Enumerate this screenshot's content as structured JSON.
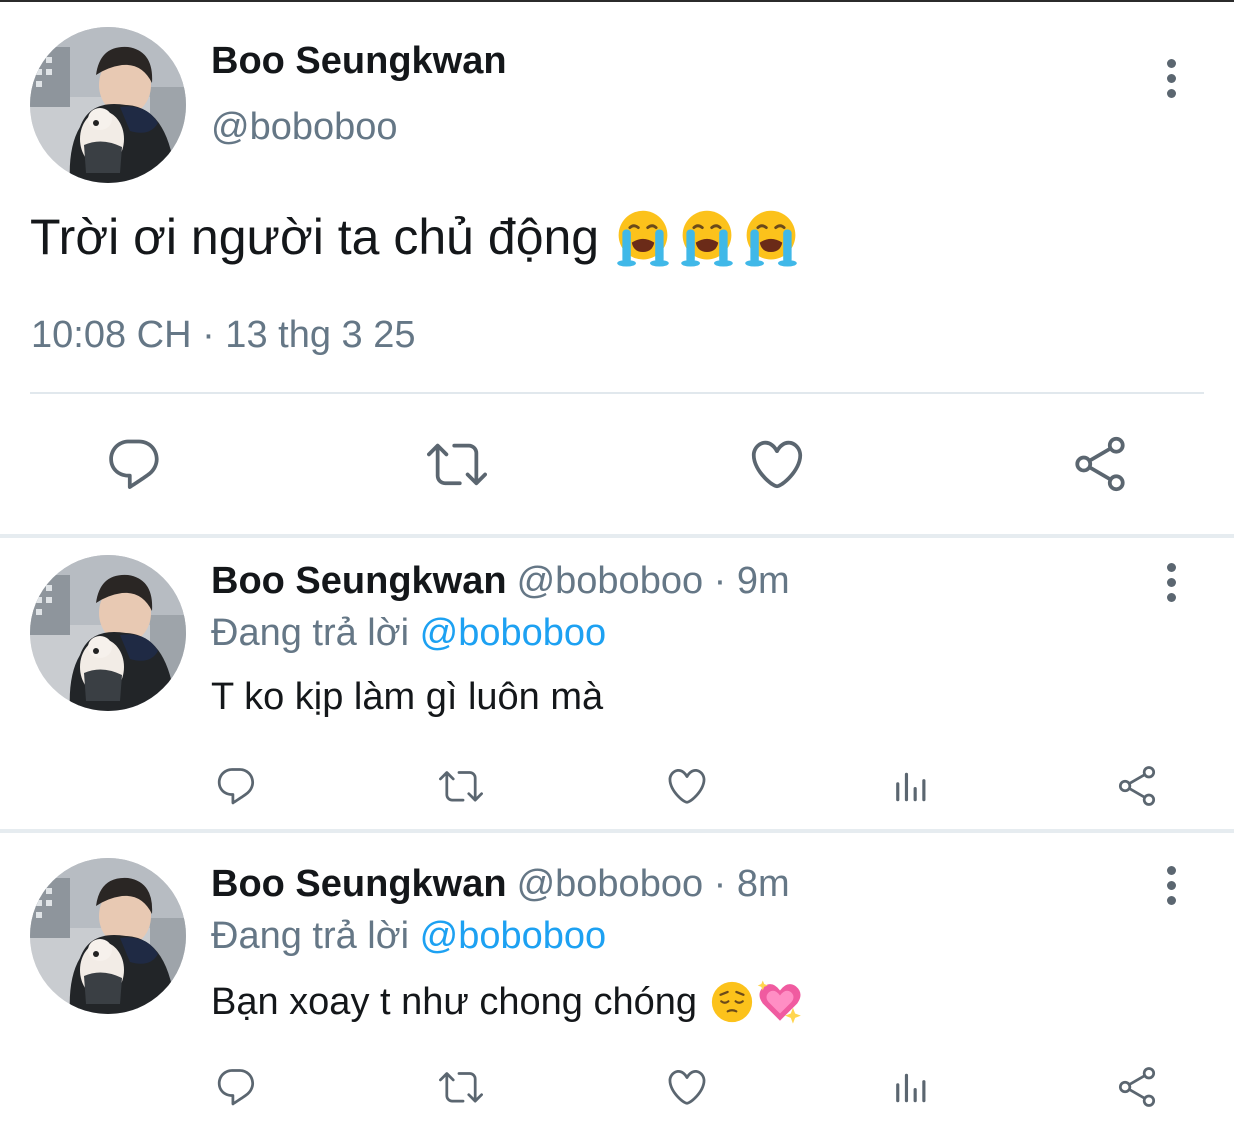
{
  "main_tweet": {
    "author_name": "Boo Seungkwan",
    "author_handle": "@boboboo",
    "text": "Trời ơi người ta chủ động",
    "emojis": [
      "loudly-crying-face",
      "loudly-crying-face",
      "loudly-crying-face"
    ],
    "timestamp": "10:08 CH · 13 thg 3 25",
    "actions": [
      "reply-icon",
      "retweet-icon",
      "like-icon",
      "share-icon"
    ]
  },
  "replies": [
    {
      "author_name": "Boo Seungkwan",
      "meta": "@boboboo · 9m",
      "replying_label": "Đang trả lời",
      "replying_to": "@boboboo",
      "text": "T ko kịp làm gì luôn mà",
      "emojis": [],
      "actions": [
        "reply-icon",
        "retweet-icon",
        "like-icon",
        "analytics-icon",
        "share-icon"
      ]
    },
    {
      "author_name": "Boo Seungkwan",
      "meta": "@boboboo · 8m",
      "replying_label": "Đang trả lời",
      "replying_to": "@boboboo",
      "text": "Bạn xoay t như chong chóng",
      "emojis": [
        "pensive-face",
        "sparkling-heart"
      ],
      "actions": [
        "reply-icon",
        "retweet-icon",
        "like-icon",
        "analytics-icon",
        "share-icon"
      ]
    }
  ],
  "colors": {
    "text_primary": "#14171a",
    "text_secondary": "#657786",
    "mention": "#1da1f2",
    "icon": "#5b6670",
    "divider": "#e1e8ed"
  }
}
